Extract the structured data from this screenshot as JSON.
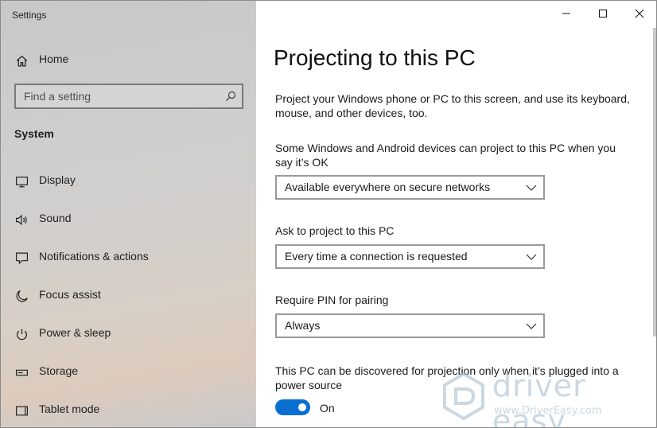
{
  "window": {
    "title": "Settings",
    "controls": {
      "minimize": "minimize-icon",
      "maximize": "maximize-icon",
      "close": "close-icon"
    }
  },
  "sidebar": {
    "home_label": "Home",
    "search": {
      "placeholder": "Find a setting",
      "icon": "search-icon"
    },
    "section": "System",
    "items": [
      {
        "label": "Display",
        "icon": "display-icon"
      },
      {
        "label": "Sound",
        "icon": "speaker-icon"
      },
      {
        "label": "Notifications & actions",
        "icon": "notifications-icon"
      },
      {
        "label": "Focus assist",
        "icon": "moon-icon"
      },
      {
        "label": "Power & sleep",
        "icon": "power-icon"
      },
      {
        "label": "Storage",
        "icon": "storage-icon"
      },
      {
        "label": "Tablet mode",
        "icon": "tablet-icon"
      }
    ]
  },
  "main": {
    "title": "Projecting to this PC",
    "intro": "Project your Windows phone or PC to this screen, and use its keyboard, mouse, and other devices, too.",
    "availability": {
      "label": "Some Windows and Android devices can project to this PC when you say it’s OK",
      "value": "Available everywhere on secure networks"
    },
    "ask": {
      "label": "Ask to project to this PC",
      "value": "Every time a connection is requested"
    },
    "pin": {
      "label": "Require PIN for pairing",
      "value": "Always"
    },
    "power": {
      "label": "This PC can be discovered for projection only when it’s plugged into a power source",
      "toggle_state": "On",
      "toggle_on": true
    }
  },
  "watermark": {
    "brand": "driver easy",
    "url": "www.DriverEasy.com"
  },
  "colors": {
    "accent": "#0a6fd1",
    "sidebar_bg": "#cccccc",
    "watermark": "#9fb9cc"
  }
}
